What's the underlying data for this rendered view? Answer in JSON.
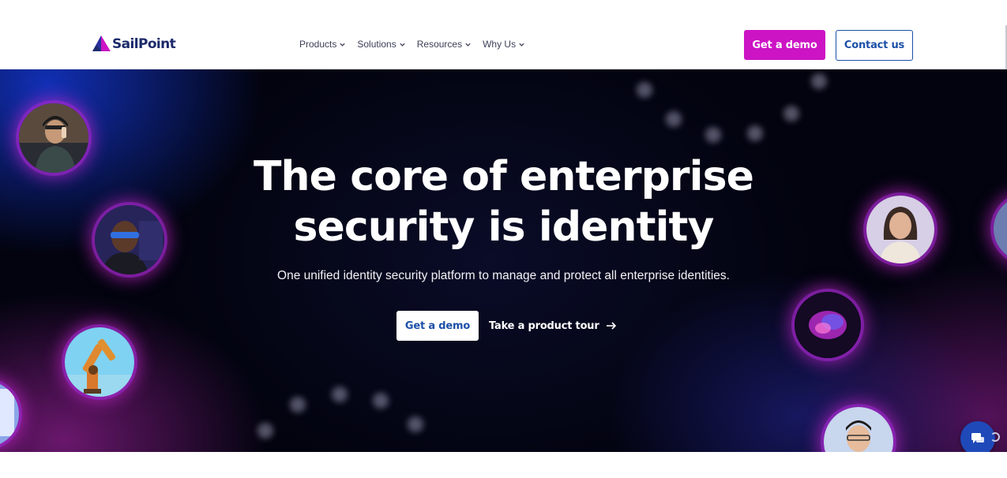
{
  "header": {
    "logo_text": "SailPoint",
    "nav": [
      {
        "label": "Products"
      },
      {
        "label": "Solutions"
      },
      {
        "label": "Resources"
      },
      {
        "label": "Why Us"
      }
    ],
    "get_demo_label": "Get a demo",
    "contact_label": "Contact us"
  },
  "hero": {
    "title_line1": "The core of enterprise",
    "title_line2": "security is identity",
    "subtitle": "One unified identity security platform to manage and protect all enterprise identities.",
    "get_demo_label": "Get a demo",
    "tour_label": "Take a product tour"
  },
  "colors": {
    "brand_magenta": "#cc14c4",
    "brand_blue": "#1c4fa8",
    "hero_bg": "#03040f"
  }
}
